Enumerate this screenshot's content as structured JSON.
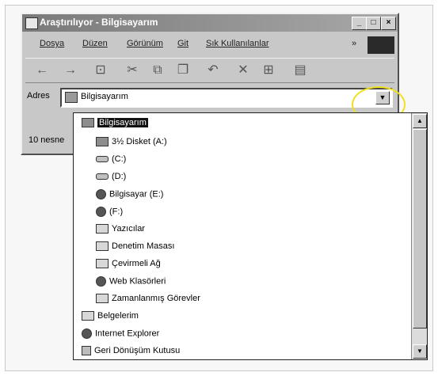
{
  "window": {
    "title": "Araştırılıyor - Bilgisayarım",
    "min_glyph": "_",
    "max_glyph": "□",
    "close_glyph": "×"
  },
  "menu": {
    "items": [
      "Dosya",
      "Düzen",
      "Görünüm",
      "Git",
      "Sık Kullanılanlar",
      "»"
    ]
  },
  "address": {
    "label": "Adres",
    "value": "Bilgisayarım",
    "dropdown_glyph": "▼"
  },
  "status": {
    "text": "10 nesne"
  },
  "dropdown": {
    "items": [
      {
        "label": "Bilgisayarım",
        "icon": "computer-icon",
        "selected": true
      },
      {
        "label": "3½ Disket (A:)",
        "icon": "floppy-icon"
      },
      {
        "label": "(C:)",
        "icon": "drive-icon"
      },
      {
        "label": "(D:)",
        "icon": "drive-icon"
      },
      {
        "label": "Bilgisayar (E:)",
        "icon": "cdrom-icon"
      },
      {
        "label": "(F:)",
        "icon": "cdrom-icon"
      },
      {
        "label": "Yazıcılar",
        "icon": "printer-folder-icon"
      },
      {
        "label": "Denetim Masası",
        "icon": "control-panel-icon"
      },
      {
        "label": "Çevirmeli Ağ",
        "icon": "network-icon"
      },
      {
        "label": "Web Klasörleri",
        "icon": "web-folder-icon"
      },
      {
        "label": "Zamanlanmış Görevler",
        "icon": "scheduled-tasks-icon"
      },
      {
        "label": "Belgelerim",
        "icon": "documents-icon"
      },
      {
        "label": "Internet Explorer",
        "icon": "ie-icon"
      },
      {
        "label": "Geri Dönüşüm Kutusu",
        "icon": "recycle-bin-icon"
      }
    ],
    "scroll_up_glyph": "▲",
    "scroll_down_glyph": "▼"
  },
  "colors": {
    "highlight_ring": "#f0e020",
    "selection": "#111111"
  }
}
